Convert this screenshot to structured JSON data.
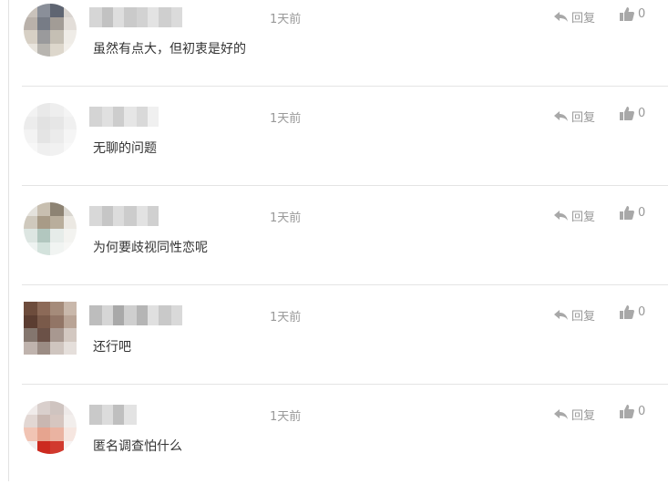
{
  "comments": [
    {
      "time": "1天前",
      "text": "虽然有点大，但初衷是好的",
      "reply_label": "回复",
      "like_count": "0",
      "avatar_pixels": [
        "#c9c2bb",
        "#8a8f99",
        "#5f6572",
        "#d8d3cf",
        "#b9b1aa",
        "#777c86",
        "#a29c96",
        "#e3ded9",
        "#d7d0c5",
        "#9a9a9c",
        "#c5bfb4",
        "#efece7",
        "#e8e4dd",
        "#b8b5b0",
        "#ddd7cc",
        "#f2efea"
      ],
      "name_pixels": [
        "#d6d6d6",
        "#c2c2c2",
        "#dedede",
        "#cacaca",
        "#d2d2d2",
        "#e3e3e3",
        "#cfcfcf",
        "#dbdbdb"
      ]
    },
    {
      "time": "1天前",
      "text": "无聊的问题",
      "reply_label": "回复",
      "like_count": "0",
      "avatar_pixels": [
        "#f2f2f2",
        "#e9e9e9",
        "#eeeeee",
        "#f4f4f4",
        "#ececec",
        "#e2e2e2",
        "#e6e6e6",
        "#f0f0f0",
        "#f3f3f3",
        "#e4e4e4",
        "#ebebeb",
        "#f5f5f5",
        "#f7f7f7",
        "#efefef",
        "#f1f1f1",
        "#f8f8f8"
      ],
      "name_pixels": [
        "#d4d4d4",
        "#e0e0e0",
        "#cdcdcd",
        "#e6e6e6",
        "#d9d9d9",
        "#f0f0f0"
      ]
    },
    {
      "time": "1天前",
      "text": "为何要歧视同性恋呢",
      "reply_label": "回复",
      "like_count": "0",
      "avatar_pixels": [
        "#e4e2dc",
        "#c8bfb0",
        "#8d8373",
        "#d9d6cf",
        "#cfc9bd",
        "#a89b87",
        "#b9ae9c",
        "#ece9e3",
        "#dde6e2",
        "#b2c7bf",
        "#e6ece9",
        "#f3f3f0",
        "#eef3f1",
        "#d3e2dc",
        "#f1f4f2",
        "#f7f7f5"
      ],
      "name_pixels": [
        "#d8d8d8",
        "#c6c6c6",
        "#dcdcdc",
        "#cccccc",
        "#e2e2e2",
        "#d0d0d0"
      ]
    },
    {
      "time": "1天前",
      "text": "还行吧",
      "reply_label": "回复",
      "like_count": "0",
      "avatar_pixels": [
        "#6d4c3c",
        "#8c6a58",
        "#a58b7a",
        "#c9b8ab",
        "#5b3d31",
        "#7a5a4a",
        "#927566",
        "#b9a496",
        "#84766e",
        "#6b5147",
        "#a89890",
        "#d3c8c1",
        "#bfb3ad",
        "#9b8c84",
        "#cfc5bf",
        "#e5dfdb"
      ],
      "name_pixels": [
        "#bdbdbd",
        "#d6d6d6",
        "#a9a9a9",
        "#cfcfcf",
        "#b5b5b5",
        "#e0e0e0",
        "#c9c9c9",
        "#d9d9d9"
      ]
    },
    {
      "time": "1天前",
      "text": "匿名调查怕什么",
      "reply_label": "回复",
      "like_count": "0",
      "avatar_pixels": [
        "#f0ebea",
        "#d9cfcc",
        "#cfc4c0",
        "#eee9e8",
        "#e2d7d3",
        "#c9b7b1",
        "#d6c6c0",
        "#f2eeec",
        "#f1c4b4",
        "#e6a48f",
        "#eab3a1",
        "#f6e6e0",
        "#f2eeee",
        "#cc2a1f",
        "#d13a2e",
        "#f7f3f3"
      ],
      "name_pixels": [
        "#c9c9c9",
        "#dcdcdc",
        "#bfbfbf",
        "#e3e3e3"
      ]
    }
  ],
  "colors": {
    "muted_text": "#999999",
    "body_text": "#333333",
    "divider": "#e4e4e4",
    "icon": "#a8a8a8"
  }
}
